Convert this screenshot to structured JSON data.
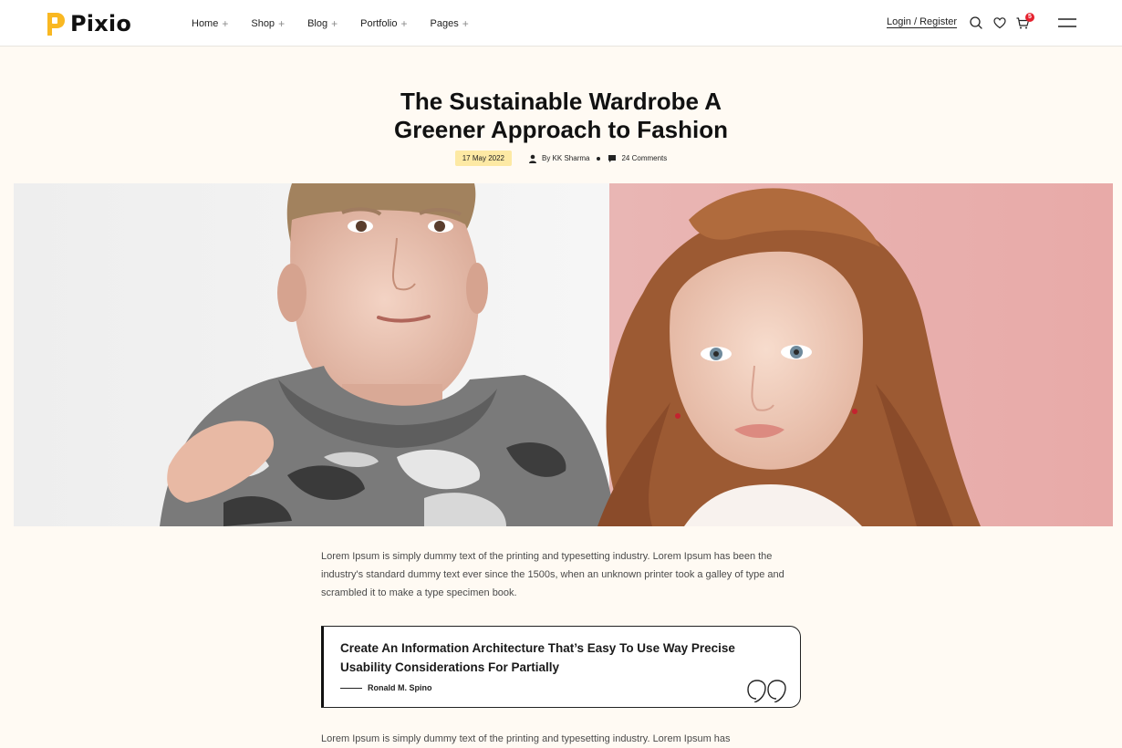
{
  "brand": {
    "name": "Pixio",
    "accent": "#f9b822"
  },
  "nav": {
    "items": [
      {
        "label": "Home",
        "icon": "+"
      },
      {
        "label": "Shop",
        "icon": "+"
      },
      {
        "label": "Blog",
        "icon": "+"
      },
      {
        "label": "Portfolio",
        "icon": "+"
      },
      {
        "label": "Pages",
        "icon": "+"
      }
    ]
  },
  "header": {
    "login_label": "Login / Register",
    "cart_count": "5",
    "icons": [
      "search-icon",
      "heart-icon",
      "cart-icon",
      "menu-icon"
    ]
  },
  "post": {
    "title_line1": "The Sustainable Wardrobe A",
    "title_line2": "Greener Approach to Fashion",
    "date": "17 May 2022",
    "author": "By KK Sharma",
    "comments": "24 Comments"
  },
  "content": {
    "paragraph1": "Lorem Ipsum is simply dummy text of the printing and typesetting industry. Lorem Ipsum has been the industry's standard dummy text ever since the 1500s, when an unknown printer took a galley of type and scrambled it to make a type specimen book.",
    "quote_text": "Create An Information Architecture That’s Easy To Use Way Precise Usability Considerations For Partially",
    "quote_author": "Ronald M. Spino",
    "paragraph2": "Lorem Ipsum is simply dummy text of the printing and typesetting industry. Lorem Ipsum has"
  },
  "colors": {
    "page_bg": "#fffaf3",
    "date_badge": "#fde9a4",
    "cart_badge": "#e5222f"
  }
}
